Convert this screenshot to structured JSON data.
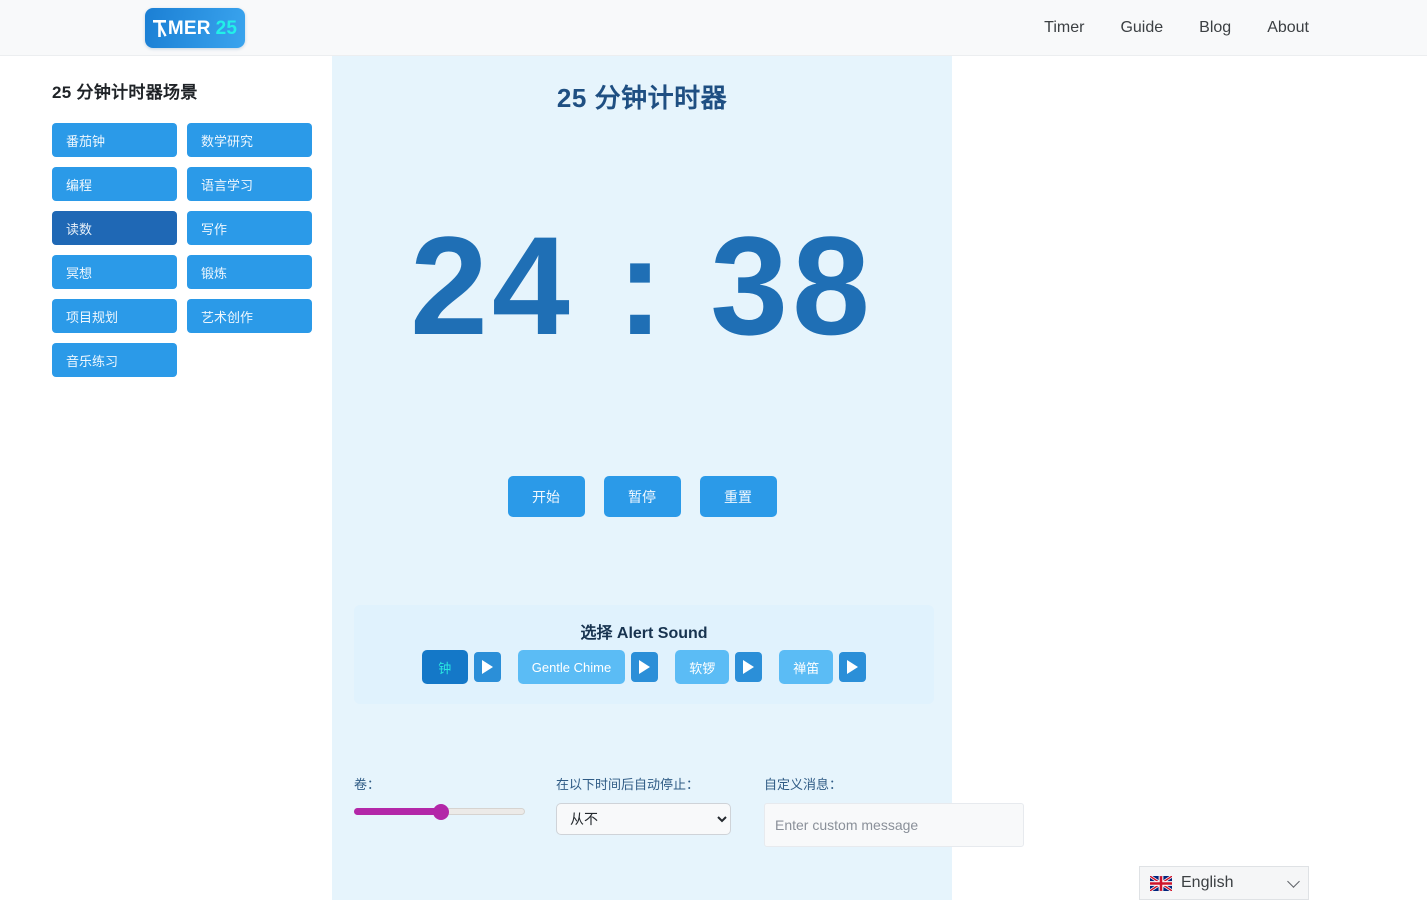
{
  "header": {
    "logo": {
      "prefix_icon": "clock-hands-icon",
      "text": "MER",
      "accent": "25",
      "accent_color": "#22f0e8"
    },
    "nav": [
      {
        "label": "Timer",
        "name": "nav-timer"
      },
      {
        "label": "Guide",
        "name": "nav-guide"
      },
      {
        "label": "Blog",
        "name": "nav-blog"
      },
      {
        "label": "About",
        "name": "nav-about"
      }
    ]
  },
  "sidebar": {
    "title": "25 分钟计时器场景",
    "scenes": [
      {
        "label": "番茄钟",
        "active": false
      },
      {
        "label": "数学研究",
        "active": false
      },
      {
        "label": "编程",
        "active": false
      },
      {
        "label": "语言学习",
        "active": false
      },
      {
        "label": "读数",
        "active": true
      },
      {
        "label": "写作",
        "active": false
      },
      {
        "label": "冥想",
        "active": false
      },
      {
        "label": "锻炼",
        "active": false
      },
      {
        "label": "项目规划",
        "active": false
      },
      {
        "label": "艺术创作",
        "active": false
      },
      {
        "label": "音乐练习",
        "active": false
      }
    ]
  },
  "timer": {
    "title": "25 分钟计时器",
    "display": "24 : 38",
    "minutes": "24",
    "seconds": "38",
    "controls": [
      {
        "label": "开始",
        "name": "start-button"
      },
      {
        "label": "暂停",
        "name": "pause-button"
      },
      {
        "label": "重置",
        "name": "reset-button"
      }
    ]
  },
  "sound": {
    "section_title": "选择 Alert Sound",
    "options": [
      {
        "label": "钟",
        "selected": true,
        "play_icon": "play-icon"
      },
      {
        "label": "Gentle Chime",
        "selected": false,
        "play_icon": "play-icon"
      },
      {
        "label": "软锣",
        "selected": false,
        "play_icon": "play-icon"
      },
      {
        "label": "禅笛",
        "selected": false,
        "play_icon": "play-icon"
      }
    ]
  },
  "settings": {
    "volume": {
      "label": "卷：",
      "value_percent": 51
    },
    "auto_stop": {
      "label": "在以下时间后自动停止：",
      "selected": "从不",
      "options": [
        "从不"
      ]
    },
    "custom_message": {
      "label": "自定义消息：",
      "value": "",
      "placeholder": "Enter custom message"
    }
  },
  "language_switcher": {
    "flag_icon": "uk-flag-icon",
    "label": "English",
    "chevron_icon": "chevron-down-icon"
  },
  "colors": {
    "panel_bg": "#e6f4fc",
    "timer_blue": "#1f6fb5",
    "button_blue": "#2b9ae8",
    "active_blue": "#1f68b5",
    "slider_magenta": "#b327a8",
    "logo_accent": "#22f0e8"
  }
}
